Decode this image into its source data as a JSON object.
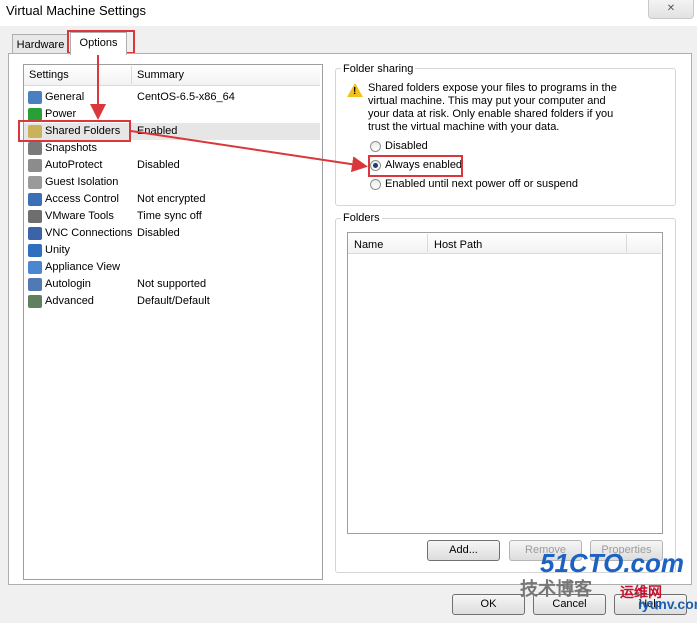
{
  "window": {
    "title": "Virtual Machine Settings",
    "close_label": "✕"
  },
  "tabs": [
    {
      "label": "Hardware"
    },
    {
      "label": "Options"
    }
  ],
  "list": {
    "headers": {
      "settings": "Settings",
      "summary": "Summary"
    },
    "items": [
      {
        "name": "General",
        "summary": "CentOS-6.5-x86_64",
        "icon": "general-icon",
        "color": "#4a7fc1"
      },
      {
        "name": "Power",
        "summary": "",
        "icon": "power-icon",
        "color": "#27a036"
      },
      {
        "name": "Shared Folders",
        "summary": "Enabled",
        "icon": "shared-folder-icon",
        "color": "#c9b35a"
      },
      {
        "name": "Snapshots",
        "summary": "",
        "icon": "snapshot-icon",
        "color": "#7a7a7a"
      },
      {
        "name": "AutoProtect",
        "summary": "Disabled",
        "icon": "autoprotect-icon",
        "color": "#8c8c8c"
      },
      {
        "name": "Guest Isolation",
        "summary": "",
        "icon": "guest-isolation-icon",
        "color": "#9a9a9a"
      },
      {
        "name": "Access Control",
        "summary": "Not encrypted",
        "icon": "access-control-icon",
        "color": "#3b6fb6"
      },
      {
        "name": "VMware Tools",
        "summary": "Time sync off",
        "icon": "vmware-tools-icon",
        "color": "#6e6e6e"
      },
      {
        "name": "VNC Connections",
        "summary": "Disabled",
        "icon": "vnc-icon",
        "color": "#3a64a8"
      },
      {
        "name": "Unity",
        "summary": "",
        "icon": "unity-icon",
        "color": "#2f6fc0"
      },
      {
        "name": "Appliance View",
        "summary": "",
        "icon": "appliance-view-icon",
        "color": "#4b86d1"
      },
      {
        "name": "Autologin",
        "summary": "Not supported",
        "icon": "autologin-icon",
        "color": "#5179b3"
      },
      {
        "name": "Advanced",
        "summary": "Default/Default",
        "icon": "advanced-icon",
        "color": "#5f7f5f"
      }
    ]
  },
  "folder_sharing": {
    "label": "Folder sharing",
    "warning": "Shared folders expose your files to programs in the virtual machine. This may put your computer and your data at risk. Only enable shared folders if you trust the virtual machine with your data.",
    "warning_lines": [
      "Shared folders expose your files to programs in the",
      "virtual machine. This may put your computer and",
      "your data at risk. Only enable shared folders if you",
      "trust the virtual machine with your data."
    ],
    "options": [
      "Disabled",
      "Always enabled",
      "Enabled until next power off or suspend"
    ],
    "selected": "Always enabled"
  },
  "folders": {
    "label": "Folders",
    "columns": [
      "Name",
      "Host Path"
    ],
    "buttons": {
      "add": "Add...",
      "remove": "Remove",
      "properties": "Properties"
    }
  },
  "footer": {
    "ok": "OK",
    "cancel": "Cancel",
    "help": "Help"
  },
  "watermark": {
    "brand": "51CTO.com",
    "line2": "技术博客",
    "line3": "运维网",
    "line4": "iyunv.com"
  },
  "colors": {
    "highlight": "#d9373c",
    "accent": "#1c3b6e"
  }
}
